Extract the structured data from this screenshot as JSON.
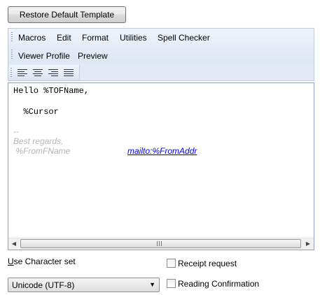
{
  "restore_button": {
    "label": "Restore Default Template"
  },
  "menubar": {
    "row1": [
      "Macros",
      "Edit",
      "Format",
      "Utilities",
      "Spell Checker"
    ],
    "row2": [
      "Viewer Profile",
      "Preview"
    ]
  },
  "align_toolbar": {
    "icons": [
      "align-left-icon",
      "align-center-icon",
      "align-right-icon",
      "align-justify-icon"
    ]
  },
  "editor": {
    "greeting": "Hello %TOFName,",
    "cursor_line": "  %Cursor",
    "sig_separator": "--",
    "sig_regards": "Best regards,",
    "sig_name": " %FromFName",
    "sig_link": "mailto:%FromAddr",
    "link_color": "#0000ee",
    "signature_color": "#b5b5b5"
  },
  "charset": {
    "label_prefix": "U",
    "label_rest": "se Character set",
    "selected": "Unicode (UTF-8)"
  },
  "options": {
    "receipt_request": {
      "label": "Receipt request",
      "checked": false
    },
    "reading_confirmation": {
      "label": "Reading Confirmation",
      "checked": false
    }
  }
}
